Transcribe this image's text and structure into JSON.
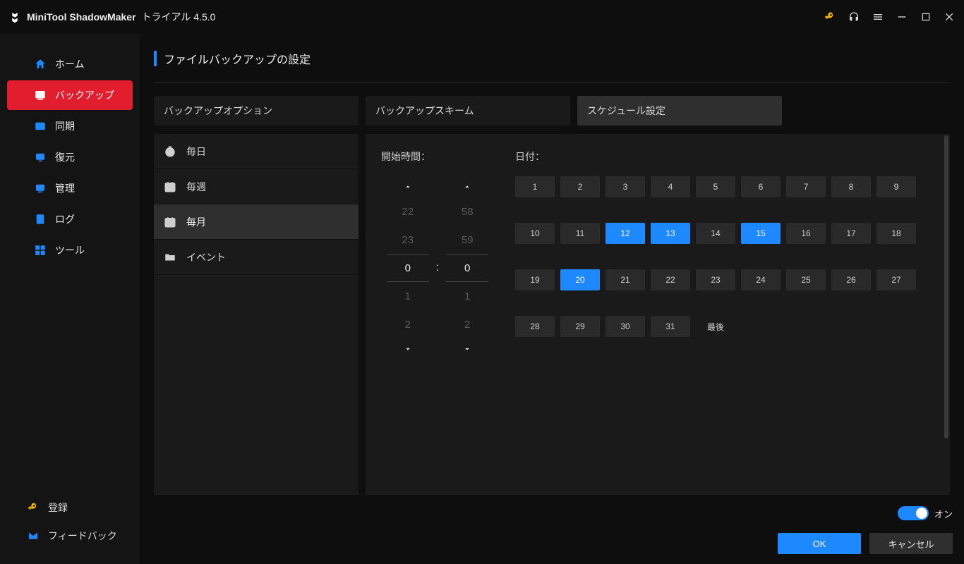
{
  "colors": {
    "accent": "#1e88ff",
    "danger": "#e11d2e",
    "key": "#f5b300"
  },
  "titlebar": {
    "brand_bold": "MiniTool ShadowMaker",
    "brand_rest": "トライアル 4.5.0",
    "icons": [
      "key-icon",
      "headphone-icon",
      "menu-icon",
      "minimize-icon",
      "maximize-icon",
      "close-icon"
    ]
  },
  "sidebar": {
    "items": [
      {
        "key": "home",
        "icon": "home-icon",
        "label": "ホーム",
        "active": false
      },
      {
        "key": "backup",
        "icon": "backup-icon",
        "label": "バックアップ",
        "active": true
      },
      {
        "key": "sync",
        "icon": "sync-icon",
        "label": "同期",
        "active": false
      },
      {
        "key": "restore",
        "icon": "restore-icon",
        "label": "復元",
        "active": false
      },
      {
        "key": "manage",
        "icon": "manage-icon",
        "label": "管理",
        "active": false
      },
      {
        "key": "log",
        "icon": "log-icon",
        "label": "ログ",
        "active": false
      },
      {
        "key": "tools",
        "icon": "tools-icon",
        "label": "ツール",
        "active": false
      }
    ],
    "bottom": [
      {
        "key": "register",
        "icon": "key-icon",
        "label": "登録"
      },
      {
        "key": "feedback",
        "icon": "mail-icon",
        "label": "フィードバック"
      }
    ]
  },
  "page": {
    "title": "ファイルバックアップの設定"
  },
  "tabs": [
    {
      "key": "options",
      "label": "バックアップオプション",
      "active": false
    },
    {
      "key": "scheme",
      "label": "バックアップスキーム",
      "active": false
    },
    {
      "key": "schedule",
      "label": "スケジュール設定",
      "active": true
    }
  ],
  "freq": {
    "items": [
      {
        "key": "daily",
        "icon": "clock-icon",
        "label": "毎日",
        "active": false
      },
      {
        "key": "weekly",
        "icon": "calendar-icon",
        "label": "毎週",
        "active": false
      },
      {
        "key": "monthly",
        "icon": "calendar-icon",
        "label": "毎月",
        "active": true
      },
      {
        "key": "event",
        "icon": "folder-icon",
        "label": "イベント",
        "active": false
      }
    ]
  },
  "schedule": {
    "start_time_label": "開始時間：",
    "date_label": "日付：",
    "hours": {
      "prev2": "22",
      "prev1": "23",
      "selected": "0",
      "next1": "1",
      "next2": "2"
    },
    "minutes": {
      "prev2": "58",
      "prev1": "59",
      "selected": "0",
      "next1": "1",
      "next2": "2"
    },
    "colon": ":",
    "days": [
      "1",
      "2",
      "3",
      "4",
      "5",
      "6",
      "7",
      "8",
      "9",
      "10",
      "11",
      "12",
      "13",
      "14",
      "15",
      "16",
      "17",
      "18",
      "19",
      "20",
      "21",
      "22",
      "23",
      "24",
      "25",
      "26",
      "27",
      "28",
      "29",
      "30",
      "31"
    ],
    "last_label": "最後",
    "selected_days": [
      "12",
      "13",
      "15",
      "20"
    ]
  },
  "footer": {
    "toggle_on": true,
    "toggle_label": "オン",
    "ok_label": "OK",
    "cancel_label": "キャンセル"
  }
}
